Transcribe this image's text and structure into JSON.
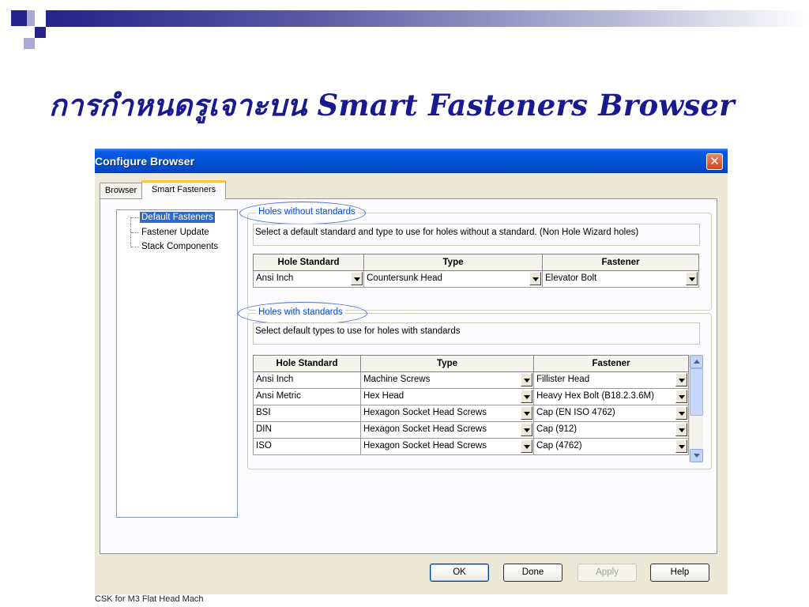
{
  "slide": {
    "title": "การกำหนดรูเจาะบน Smart Fasteners Browser"
  },
  "dialog": {
    "title": "Configure Browser",
    "close_symbol": "✕",
    "tabs": [
      {
        "label": "Browser"
      },
      {
        "label": "Smart Fasteners"
      }
    ],
    "tree": {
      "items": [
        {
          "label": "Default Fasteners",
          "selected": true
        },
        {
          "label": "Fastener Update"
        },
        {
          "label": "Stack Components"
        }
      ]
    },
    "group_without": {
      "legend": "Holes without standards",
      "description": "Select a default standard and type to use for holes without a standard.  (Non Hole Wizard holes)",
      "headers": [
        "Hole Standard",
        "Type",
        "Fastener"
      ],
      "row": {
        "hole_standard": "Ansi Inch",
        "type": "Countersunk Head",
        "fastener": "Elevator Bolt"
      }
    },
    "group_with": {
      "legend": "Holes with standards",
      "description": "Select default types to use for holes with standards",
      "headers": [
        "Hole Standard",
        "Type",
        "Fastener"
      ],
      "rows": [
        {
          "hole_standard": "Ansi Inch",
          "type": "Machine Screws",
          "fastener": "Fillister Head"
        },
        {
          "hole_standard": "Ansi Metric",
          "type": "Hex Head",
          "fastener": "Heavy Hex Bolt (B18.2.3.6M)"
        },
        {
          "hole_standard": "BSI",
          "type": "Hexagon Socket Head Screws",
          "fastener": "Cap (EN ISO 4762)"
        },
        {
          "hole_standard": "DIN",
          "type": "Hexagon Socket Head Screws",
          "fastener": "Cap (912)"
        },
        {
          "hole_standard": "ISO",
          "type": "Hexagon Socket Head Screws",
          "fastener": "Cap (4762)"
        }
      ]
    },
    "buttons": {
      "ok": "OK",
      "done": "Done",
      "apply": "Apply",
      "help": "Help"
    }
  },
  "taskbar_snippet": "CSK for M3 Flat Head Mach"
}
